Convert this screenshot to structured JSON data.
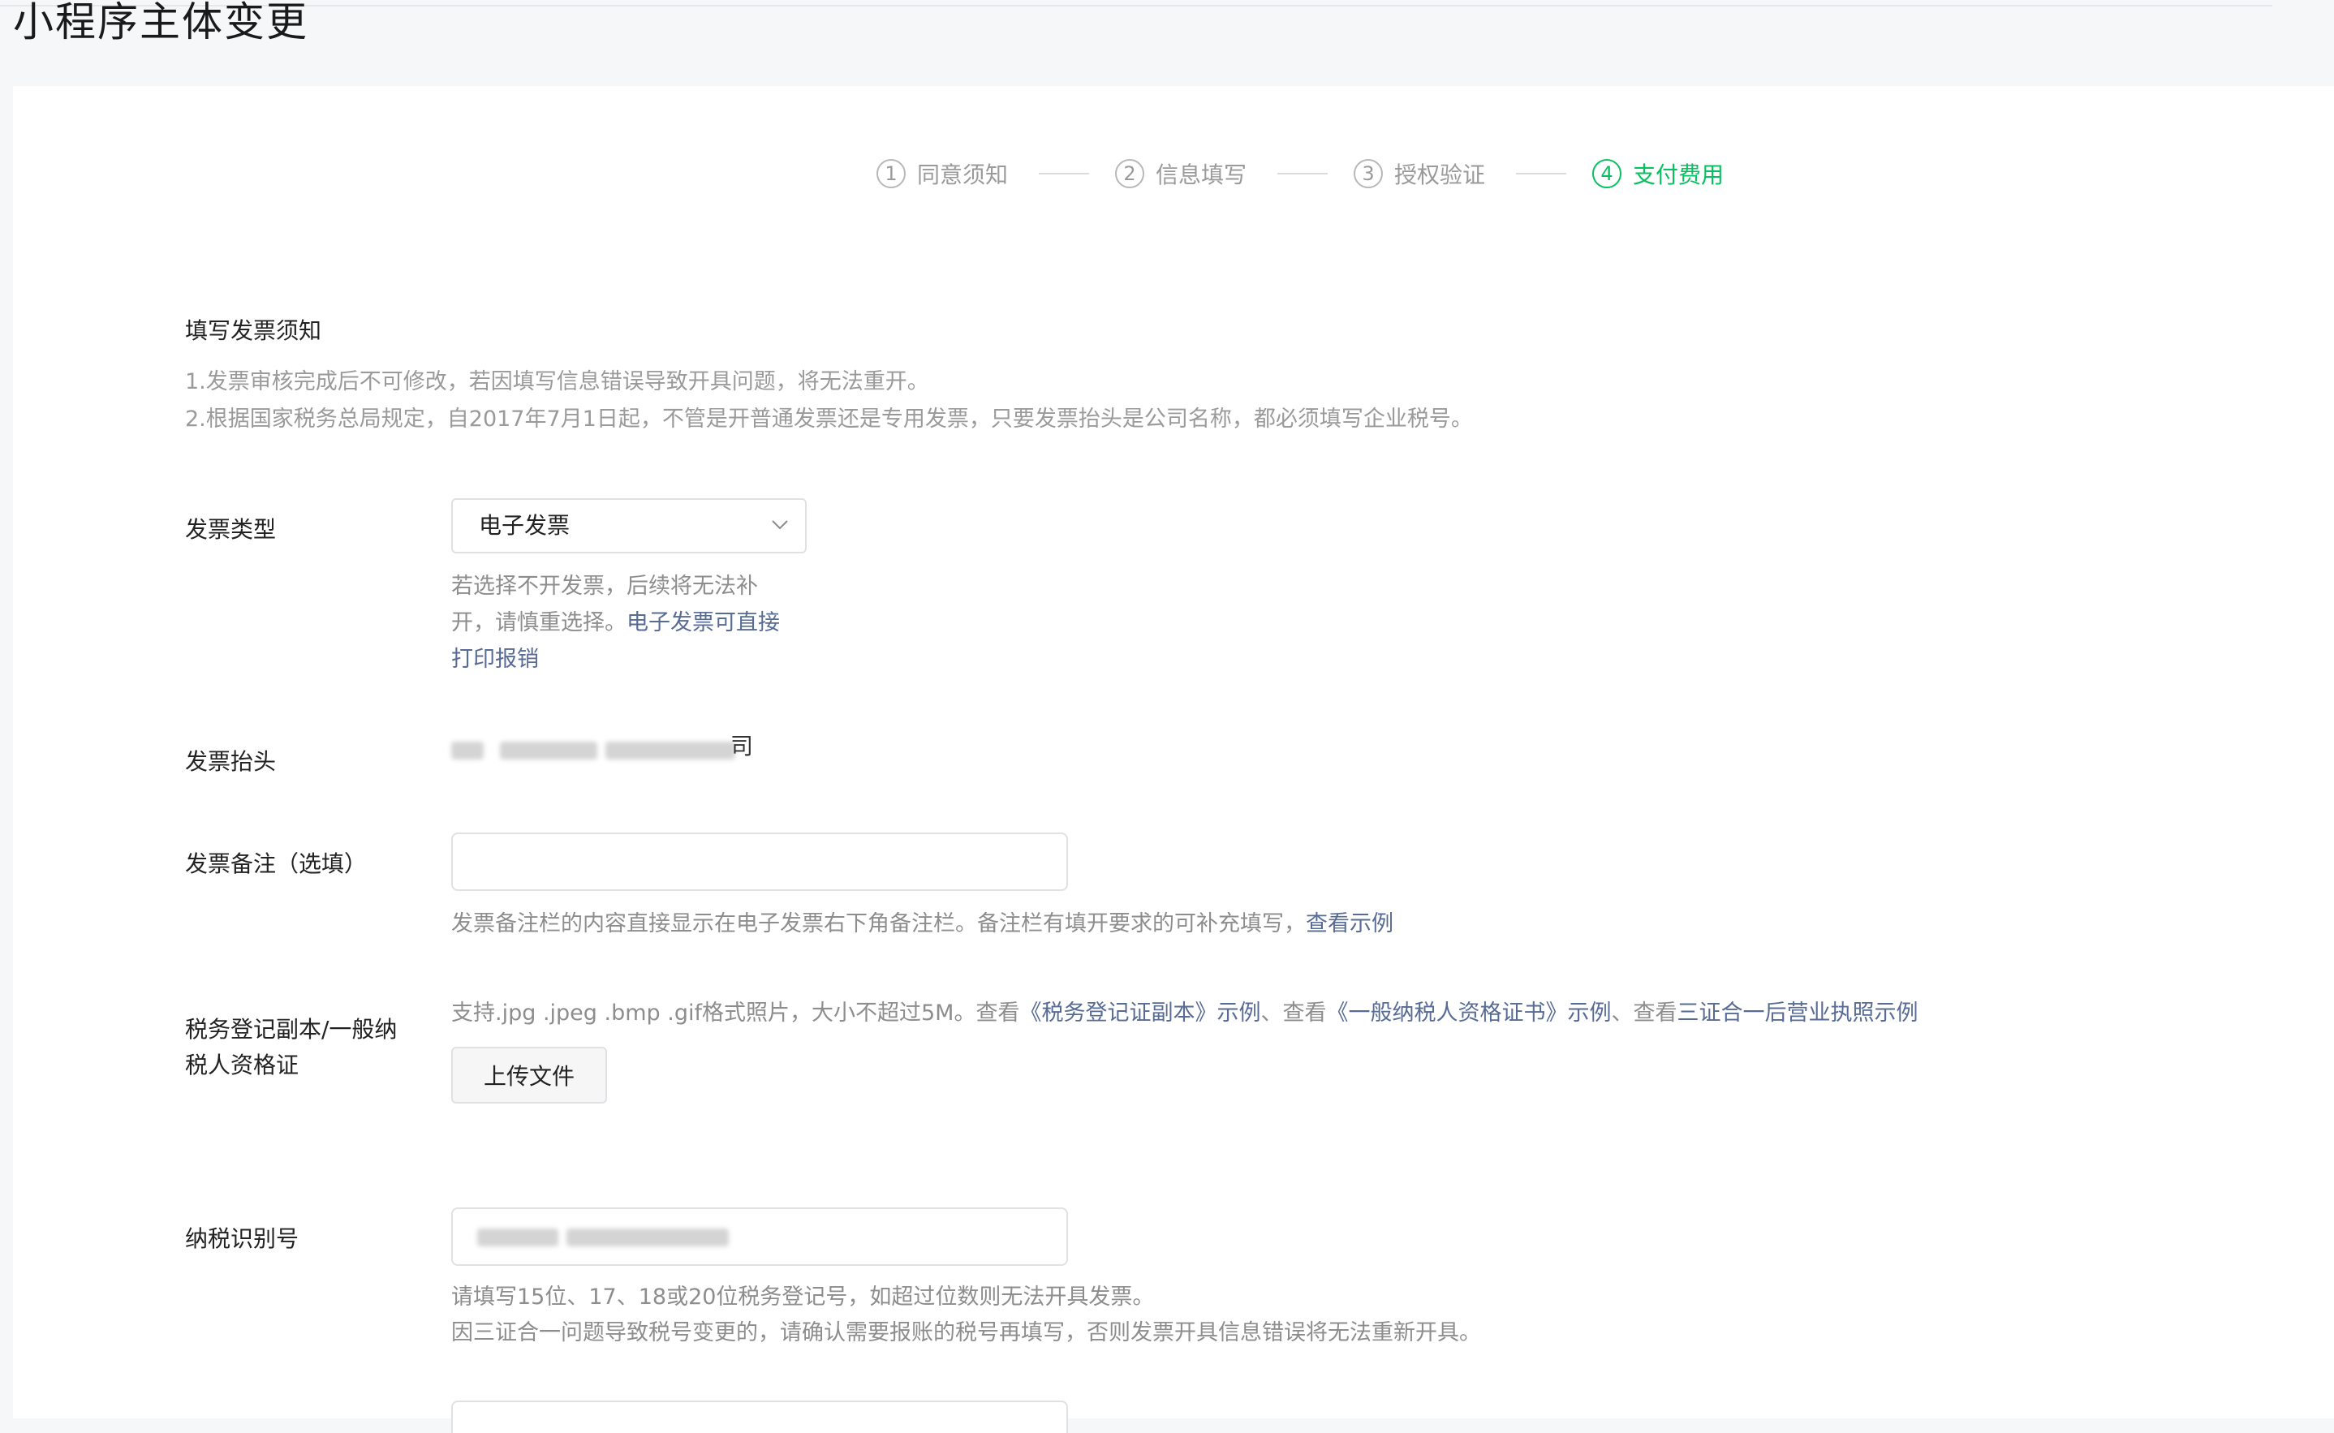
{
  "page": {
    "title": "小程序主体变更"
  },
  "steps": [
    {
      "num": "1",
      "label": "同意须知"
    },
    {
      "num": "2",
      "label": "信息填写"
    },
    {
      "num": "3",
      "label": "授权验证"
    },
    {
      "num": "4",
      "label": "支付费用"
    }
  ],
  "notice": {
    "title": "填写发票须知",
    "line1": "1.发票审核完成后不可修改，若因填写信息错误导致开具问题，将无法重开。",
    "line2": "2.根据国家税务总局规定，自2017年7月1日起，不管是开普通发票还是专用发票，只要发票抬头是公司名称，都必须填写企业税号。"
  },
  "invoice_type": {
    "label": "发票类型",
    "selected": "电子发票",
    "tip_line1": "若选择不开发票，后续将无法补",
    "tip_line2_text": "开，请慎重选择。",
    "tip_line2_link": "电子发票可直接",
    "tip_line3_link": "打印报销"
  },
  "invoice_header": {
    "label": "发票抬头",
    "value_tail": "司"
  },
  "invoice_note": {
    "label": "发票备注（选填）",
    "tip": "发票备注栏的内容直接显示在电子发票右下角备注栏。备注栏有填开要求的可补充填写，",
    "tip_link": "查看示例"
  },
  "tax_cert": {
    "label_line1": "税务登记副本/一般纳",
    "label_line2": "税人资格证",
    "tip_prefix": "支持.jpg .jpeg .bmp .gif格式照片，大小不超过5M。查看",
    "link1": "《税务登记证副本》示例",
    "sep1": "、查看",
    "link2": "《一般纳税人资格证书》示例",
    "sep2": "、查看",
    "link3": "三证合一后营业执照示例",
    "upload_label": "上传文件"
  },
  "tax_id": {
    "label": "纳税识别号",
    "tip1": "请填写15位、17、18或20位税务登记号，如超过位数则无法开具发票。",
    "tip2": "因三证合一问题导致税号变更的，请确认需要报账的税号再填写，否则发票开具信息错误将无法重新开具。"
  },
  "colors": {
    "accent": "#07c160",
    "link": "#576b95"
  }
}
